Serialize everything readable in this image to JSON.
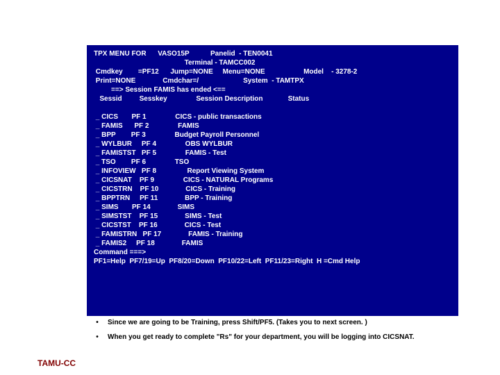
{
  "terminal": {
    "header": {
      "title": "TPX MENU FOR",
      "vaso": "VASO15P",
      "panelid_label": "Panelid",
      "panelid": "- TEN0041",
      "terminal_label": "Terminal",
      "terminal": "- TAMCC002",
      "cmdkey_label": "Cmdkey",
      "cmdkey": "=PF12",
      "jump_label": "Jump=NONE",
      "menu_label": "Menu=NONE",
      "model_label": "Model",
      "model": "- 3278-2",
      "print_label": "Print=NONE",
      "cmdchar_label": "Cmdchar=/",
      "system_label": "System",
      "system": "- TAMTPX",
      "banner": "==> Session FAMIS has ended <==",
      "col_sessid": "Sessid",
      "col_sesskey": "Sesskey",
      "col_desc": "Session Description",
      "col_status": "Status"
    },
    "sessions": [
      {
        "id": "CICS",
        "key": "PF 1",
        "desc": "CICS - public transactions"
      },
      {
        "id": "FAMIS",
        "key": "PF 2",
        "desc": "FAMIS"
      },
      {
        "id": "BPP",
        "key": "PF 3",
        "desc": "Budget Payroll Personnel"
      },
      {
        "id": "WYLBUR",
        "key": "PF 4",
        "desc": "OBS WYLBUR"
      },
      {
        "id": "FAMISTST",
        "key": "PF 5",
        "desc": "FAMIS - Test"
      },
      {
        "id": "TSO",
        "key": "PF 6",
        "desc": "TSO"
      },
      {
        "id": "INFOVIEW",
        "key": "PF 8",
        "desc": " Report Viewing System"
      },
      {
        "id": "CICSNAT",
        "key": "PF 9",
        "desc": "CICS - NATURAL Programs"
      },
      {
        "id": "CICSTRN",
        "key": "PF 10",
        "desc": "CICS - Training"
      },
      {
        "id": "BPPTRN",
        "key": "PF 11",
        "desc": "BPP - Training"
      },
      {
        "id": "SIMS",
        "key": "PF 14",
        "desc": "SIMS"
      },
      {
        "id": "SIMSTST",
        "key": "PF 15",
        "desc": "SIMS - Test"
      },
      {
        "id": "CICSTST",
        "key": "PF 16",
        "desc": "CICS - Test"
      },
      {
        "id": "FAMISTRN",
        "key": "PF 17",
        "desc": "FAMIS - Training"
      },
      {
        "id": "FAMIS2",
        "key": "PF 18",
        "desc": "FAMIS"
      }
    ],
    "command_prompt": "Command ===>",
    "pf_help": "PF1=Help  PF7/19=Up  PF8/20=Down  PF10/22=Left  PF11/23=Right  H =Cmd Help"
  },
  "instructions": [
    "Since we are going to be Training, press Shift/PF5.  (Takes you to next screen. )",
    "When you get ready to complete \"Rs\" for your department, you will be logging into CICSNAT."
  ],
  "footer": "TAMU-CC",
  "bullet": "•"
}
